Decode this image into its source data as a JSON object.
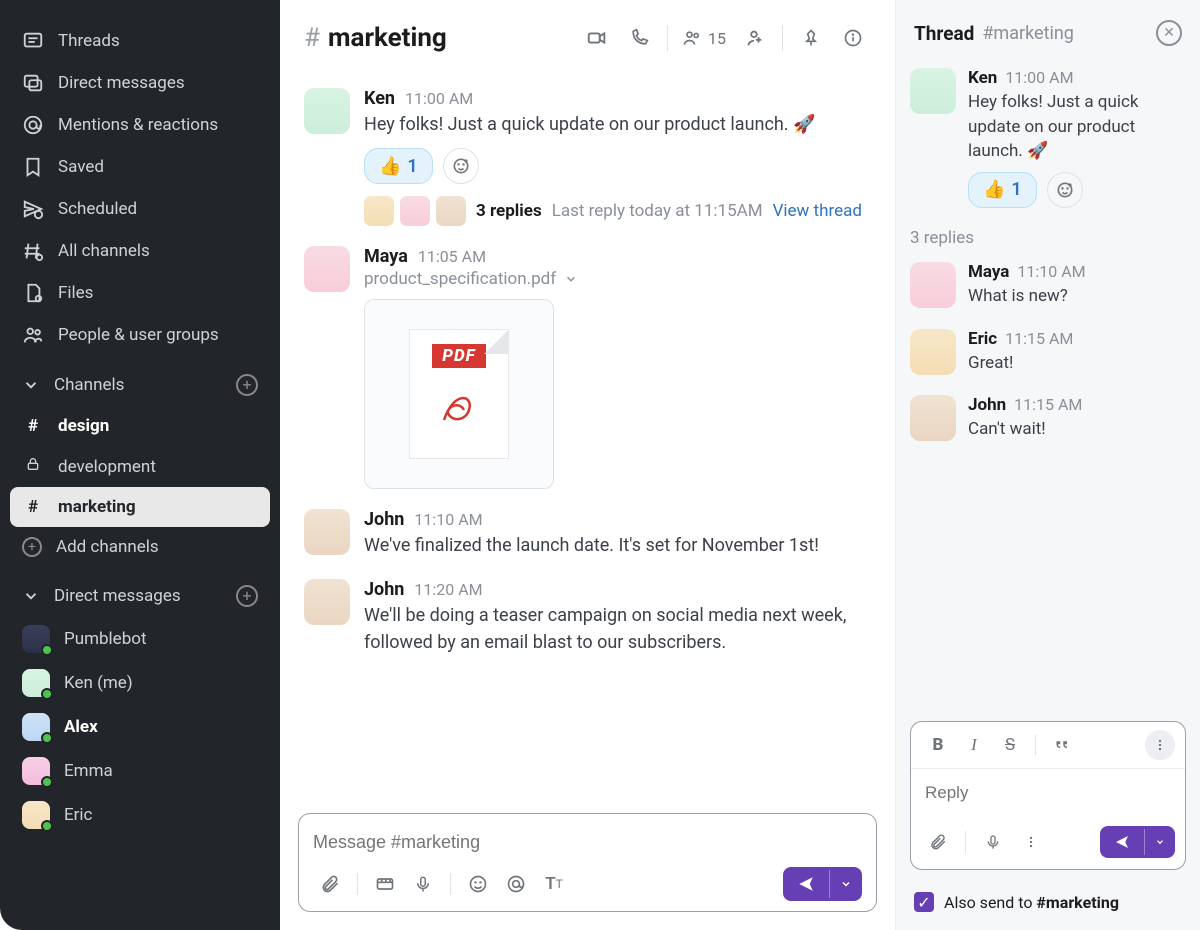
{
  "sidebar": {
    "top_items": [
      {
        "label": "Threads",
        "icon": "threads"
      },
      {
        "label": "Direct messages",
        "icon": "dm"
      },
      {
        "label": "Mentions & reactions",
        "icon": "mention"
      },
      {
        "label": "Saved",
        "icon": "bookmark"
      },
      {
        "label": "Scheduled",
        "icon": "scheduled"
      },
      {
        "label": "All channels",
        "icon": "all-channels"
      },
      {
        "label": "Files",
        "icon": "files"
      },
      {
        "label": "People & user groups",
        "icon": "people"
      }
    ],
    "channels_header": "Channels",
    "channels": [
      {
        "name": "design",
        "type": "hash",
        "bold": true,
        "active": false
      },
      {
        "name": "development",
        "type": "lock",
        "bold": false,
        "active": false
      },
      {
        "name": "marketing",
        "type": "hash",
        "bold": true,
        "active": true
      }
    ],
    "add_channels": "Add channels",
    "dm_header": "Direct messages",
    "dms": [
      {
        "name": "Pumblebot",
        "avatar": "bot",
        "bold": false
      },
      {
        "name": "Ken (me)",
        "avatar": "ken",
        "bold": false
      },
      {
        "name": "Alex",
        "avatar": "alex",
        "bold": true
      },
      {
        "name": "Emma",
        "avatar": "emma",
        "bold": false
      },
      {
        "name": "Eric",
        "avatar": "eric",
        "bold": false
      }
    ]
  },
  "channel": {
    "hash": "#",
    "name": "marketing",
    "member_count": "15"
  },
  "messages": [
    {
      "author": "Ken",
      "time": "11:00 AM",
      "avatar": "ken",
      "text": "Hey folks! Just a quick update on our product launch. 🚀",
      "reactions": [
        {
          "emoji": "👍",
          "count": "1"
        }
      ],
      "thread": {
        "avatars": [
          "eric",
          "maya",
          "john"
        ],
        "replies": "3 replies",
        "last": "Last reply today at 11:15AM",
        "link": "View thread"
      }
    },
    {
      "author": "Maya",
      "time": "11:05 AM",
      "avatar": "maya",
      "file": {
        "name": "product_specification.pdf",
        "badge": "PDF"
      }
    },
    {
      "author": "John",
      "time": "11:10 AM",
      "avatar": "john",
      "text": "We've finalized the launch date. It's set for November 1st!"
    },
    {
      "author": "John",
      "time": "11:20 AM",
      "avatar": "john",
      "text": "We'll be doing a teaser campaign on social media next week, followed by an email blast to our subscribers."
    }
  ],
  "composer": {
    "placeholder": "Message #marketing"
  },
  "thread": {
    "title": "Thread",
    "channel": "#marketing",
    "root": {
      "author": "Ken",
      "time": "11:00 AM",
      "avatar": "ken",
      "text": "Hey folks! Just a quick update on our product launch. 🚀",
      "reactions": [
        {
          "emoji": "👍",
          "count": "1"
        }
      ]
    },
    "replies_label": "3 replies",
    "replies": [
      {
        "author": "Maya",
        "time": "11:10 AM",
        "avatar": "maya",
        "text": "What is new?"
      },
      {
        "author": "Eric",
        "time": "11:15 AM",
        "avatar": "eric",
        "text": "Great!"
      },
      {
        "author": "John",
        "time": "11:15 AM",
        "avatar": "john",
        "text": "Can't wait!"
      }
    ],
    "composer_placeholder": "Reply",
    "also_send_prefix": "Also send to ",
    "also_send_channel": "#marketing"
  }
}
